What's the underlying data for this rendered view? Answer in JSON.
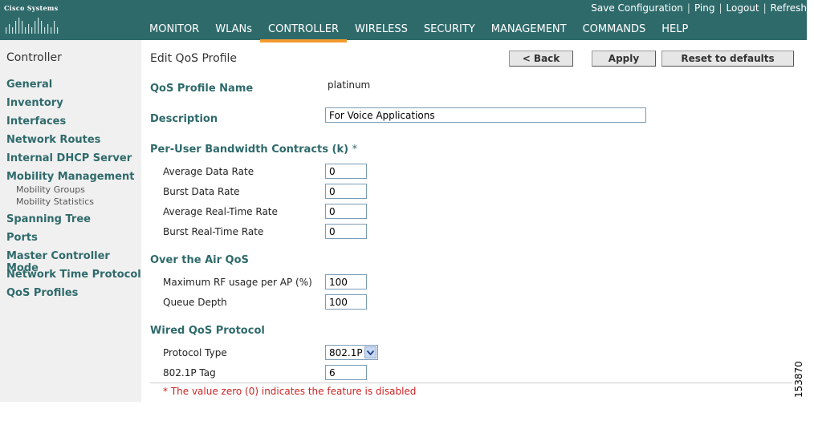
{
  "brand": {
    "name": "Cisco Systems"
  },
  "top_links": [
    "Save Configuration",
    "Ping",
    "Logout",
    "Refresh"
  ],
  "nav": {
    "items": [
      "MONITOR",
      "WLANs",
      "CONTROLLER",
      "WIRELESS",
      "SECURITY",
      "MANAGEMENT",
      "COMMANDS",
      "HELP"
    ],
    "active": "CONTROLLER",
    "active_color": "#f29a2e"
  },
  "sidebar": {
    "title": "Controller",
    "items": [
      "General",
      "Inventory",
      "Interfaces",
      "Network Routes",
      "Internal DHCP Server",
      "Mobility Management",
      "Spanning Tree",
      "Ports",
      "Master Controller Mode",
      "Network Time Protocol",
      "QoS Profiles"
    ],
    "sub_items": [
      "Mobility Groups",
      "Mobility Statistics"
    ]
  },
  "page": {
    "title": "Edit QoS Profile",
    "buttons": {
      "back": "< Back",
      "apply": "Apply",
      "reset": "Reset to defaults"
    }
  },
  "form": {
    "profile_name_label": "QoS Profile Name",
    "profile_name_value": "platinum",
    "description_label": "Description",
    "description_value": "For Voice Applications",
    "bandwidth_section": "Per-User Bandwidth Contracts (k)",
    "bandwidth_asterisk": "*",
    "avg_data_rate_label": "Average Data Rate",
    "avg_data_rate_value": "0",
    "burst_data_rate_label": "Burst Data Rate",
    "burst_data_rate_value": "0",
    "avg_rt_rate_label": "Average Real-Time Rate",
    "avg_rt_rate_value": "0",
    "burst_rt_rate_label": "Burst Real-Time Rate",
    "burst_rt_rate_value": "0",
    "air_section": "Over the Air QoS",
    "max_rf_label": "Maximum RF usage per AP (%)",
    "max_rf_value": "100",
    "queue_depth_label": "Queue Depth",
    "queue_depth_value": "100",
    "wired_section": "Wired QoS Protocol",
    "protocol_type_label": "Protocol Type",
    "protocol_type_value": "802.1P",
    "tag_label": "802.1P Tag",
    "tag_value": "6",
    "note": "* The value zero (0) indicates the feature is disabled"
  },
  "figure_id": "153870",
  "colors": {
    "header": "#2f6a6b",
    "section": "#2f6a6b",
    "note": "#cc2222"
  }
}
